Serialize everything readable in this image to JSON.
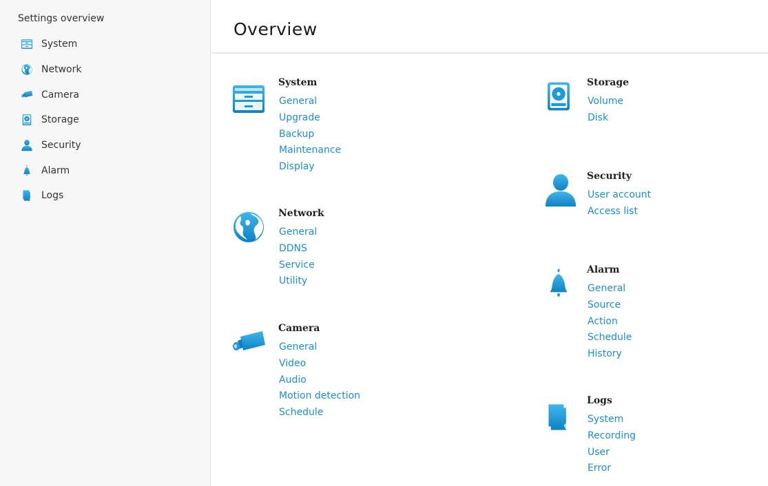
{
  "sidebar": {
    "title": "Settings overview",
    "items": [
      {
        "label": "System",
        "icon": "system-icon"
      },
      {
        "label": "Network",
        "icon": "globe-icon"
      },
      {
        "label": "Camera",
        "icon": "camera-icon"
      },
      {
        "label": "Storage",
        "icon": "storage-icon"
      },
      {
        "label": "Security",
        "icon": "user-icon"
      },
      {
        "label": "Alarm",
        "icon": "bell-icon"
      },
      {
        "label": "Logs",
        "icon": "logs-icon"
      }
    ]
  },
  "header": {
    "title": "Overview"
  },
  "sections": {
    "system": {
      "title": "System",
      "icon": "system-icon",
      "links": [
        "General",
        "Upgrade",
        "Backup",
        "Maintenance",
        "Display"
      ]
    },
    "network": {
      "title": "Network",
      "icon": "globe-icon",
      "links": [
        "General",
        "DDNS",
        "Service",
        "Utility"
      ]
    },
    "camera": {
      "title": "Camera",
      "icon": "camera-icon",
      "links": [
        "General",
        "Video",
        "Audio",
        "Motion detection",
        "Schedule"
      ]
    },
    "storage": {
      "title": "Storage",
      "icon": "storage-icon",
      "links": [
        "Volume",
        "Disk"
      ]
    },
    "security": {
      "title": "Security",
      "icon": "user-icon",
      "links": [
        "User account",
        "Access list"
      ]
    },
    "alarm": {
      "title": "Alarm",
      "icon": "bell-icon",
      "links": [
        "General",
        "Source",
        "Action",
        "Schedule",
        "History"
      ]
    },
    "logs": {
      "title": "Logs",
      "icon": "logs-icon",
      "links": [
        "System",
        "Recording",
        "User",
        "Error"
      ]
    }
  },
  "colors": {
    "accent": "#1a8fd0",
    "icon_blue": "#1e9ad6",
    "icon_dark": "#0d6fa8"
  }
}
